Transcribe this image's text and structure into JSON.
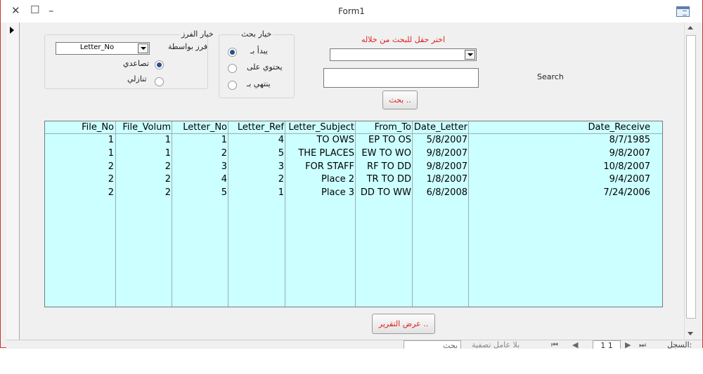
{
  "window": {
    "title": "Form1"
  },
  "sort_group": {
    "title": "خيار الفرز",
    "by_label": "فرز بواسطة",
    "field_value": "Letter_No",
    "options": [
      "تصاعدي",
      "تنازلي"
    ],
    "selected": 0
  },
  "search_group": {
    "title": "خيار بحث",
    "options": [
      "يبدأ بـ",
      "يحتوي على",
      "ينتهي بـ"
    ],
    "selected": 0
  },
  "search_field": {
    "label": "اختر حقل للبحث من خلاله",
    "value": ""
  },
  "search_text": {
    "label": "Search",
    "value": ""
  },
  "search_button": {
    "label": "بحث .."
  },
  "report_button": {
    "label": "عرض التقرير .."
  },
  "table": {
    "columns": [
      "File_No",
      "File_Volum",
      "Letter_No",
      "Letter_Ref",
      "Letter_Subject",
      "From_To",
      "Date_Letter",
      "Date_Receive"
    ],
    "rows": [
      [
        "1",
        "1",
        "1",
        "4",
        "TO OWS",
        "EP TO OS",
        "5/8/2007",
        "8/7/1985"
      ],
      [
        "1",
        "1",
        "2",
        "5",
        "THE PLACES",
        "EW TO WO",
        "9/8/2007",
        "9/8/2007"
      ],
      [
        "2",
        "2",
        "3",
        "3",
        "FOR STAFF",
        "RF TO DD",
        "9/8/2007",
        "10/8/2007"
      ],
      [
        "2",
        "2",
        "4",
        "2",
        "Place 2",
        "TR TO DD",
        "1/8/2007",
        "9/4/2007"
      ],
      [
        "2",
        "2",
        "5",
        "1",
        "Place 3",
        "DD TO WW",
        "6/8/2008",
        "7/24/2006"
      ]
    ]
  },
  "navigation": {
    "record_label": "السجل:",
    "position": "1 1",
    "filter_label": "بلا عامل تصفية",
    "search_placeholder": "بحث"
  },
  "colors": {
    "grid_background": "#ccffff",
    "accent_red": "#e02020",
    "radio_selected": "#2a4f8f"
  }
}
